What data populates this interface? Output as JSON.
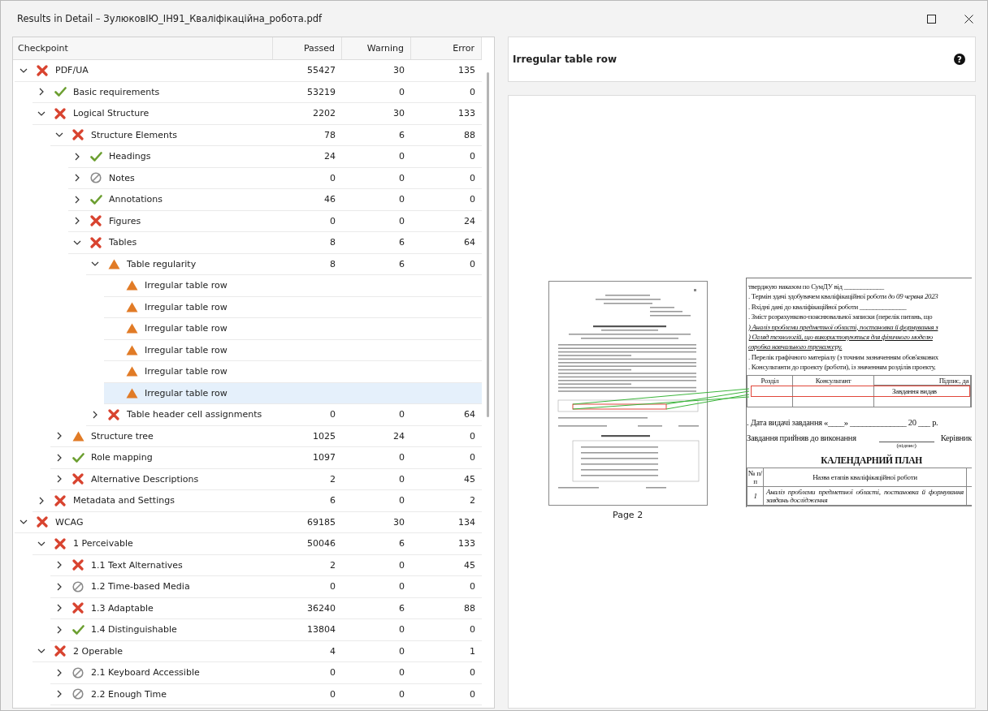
{
  "window": {
    "title": "Results in Detail – ЗулюковІЮ_ІН91_Кваліфікаційна_робота.pdf"
  },
  "table": {
    "columns": [
      "Checkpoint",
      "Passed",
      "Warning",
      "Error"
    ],
    "rows": [
      {
        "label": "PDF/UA",
        "kind": "error",
        "expanded": true,
        "selected": false,
        "passed": "55427",
        "warning": "30",
        "error": "135",
        "children": [
          {
            "label": "Basic requirements",
            "kind": "passed",
            "expanded": false,
            "selected": false,
            "passed": "53219",
            "warning": "0",
            "error": "0"
          },
          {
            "label": "Logical Structure",
            "kind": "error",
            "expanded": true,
            "selected": false,
            "passed": "2202",
            "warning": "30",
            "error": "133",
            "children": [
              {
                "label": "Structure Elements",
                "kind": "error",
                "expanded": true,
                "selected": false,
                "passed": "78",
                "warning": "6",
                "error": "88",
                "children": [
                  {
                    "label": "Headings",
                    "kind": "passed",
                    "expanded": false,
                    "selected": false,
                    "passed": "24",
                    "warning": "0",
                    "error": "0"
                  },
                  {
                    "label": "Notes",
                    "kind": "skipped",
                    "expanded": false,
                    "selected": false,
                    "passed": "0",
                    "warning": "0",
                    "error": "0"
                  },
                  {
                    "label": "Annotations",
                    "kind": "passed",
                    "expanded": false,
                    "selected": false,
                    "passed": "46",
                    "warning": "0",
                    "error": "0"
                  },
                  {
                    "label": "Figures",
                    "kind": "error",
                    "expanded": false,
                    "selected": false,
                    "passed": "0",
                    "warning": "0",
                    "error": "24"
                  },
                  {
                    "label": "Tables",
                    "kind": "error",
                    "expanded": true,
                    "selected": false,
                    "passed": "8",
                    "warning": "6",
                    "error": "64",
                    "children": [
                      {
                        "label": "Table regularity",
                        "kind": "warning",
                        "expanded": true,
                        "selected": false,
                        "passed": "8",
                        "warning": "6",
                        "error": "0",
                        "children": [
                          {
                            "label": "Irregular table row",
                            "kind": "warning",
                            "selected": false
                          },
                          {
                            "label": "Irregular table row",
                            "kind": "warning",
                            "selected": false
                          },
                          {
                            "label": "Irregular table row",
                            "kind": "warning",
                            "selected": false
                          },
                          {
                            "label": "Irregular table row",
                            "kind": "warning",
                            "selected": false
                          },
                          {
                            "label": "Irregular table row",
                            "kind": "warning",
                            "selected": false
                          },
                          {
                            "label": "Irregular table row",
                            "kind": "warning",
                            "selected": true
                          }
                        ]
                      },
                      {
                        "label": "Table header cell assignments",
                        "kind": "error",
                        "expanded": false,
                        "selected": false,
                        "passed": "0",
                        "warning": "0",
                        "error": "64"
                      }
                    ]
                  }
                ]
              },
              {
                "label": "Structure tree",
                "kind": "warning",
                "expanded": false,
                "selected": false,
                "passed": "1025",
                "warning": "24",
                "error": "0"
              },
              {
                "label": "Role mapping",
                "kind": "passed",
                "expanded": false,
                "selected": false,
                "passed": "1097",
                "warning": "0",
                "error": "0"
              },
              {
                "label": "Alternative Descriptions",
                "kind": "error",
                "expanded": false,
                "selected": false,
                "passed": "2",
                "warning": "0",
                "error": "45"
              }
            ]
          },
          {
            "label": "Metadata and Settings",
            "kind": "error",
            "expanded": false,
            "selected": false,
            "passed": "6",
            "warning": "0",
            "error": "2"
          }
        ]
      },
      {
        "label": "WCAG",
        "kind": "error",
        "expanded": true,
        "selected": false,
        "passed": "69185",
        "warning": "30",
        "error": "134",
        "children": [
          {
            "label": "1 Perceivable",
            "kind": "error",
            "expanded": true,
            "selected": false,
            "passed": "50046",
            "warning": "6",
            "error": "133",
            "children": [
              {
                "label": "1.1 Text Alternatives",
                "kind": "error",
                "expanded": false,
                "selected": false,
                "passed": "2",
                "warning": "0",
                "error": "45"
              },
              {
                "label": "1.2 Time-based Media",
                "kind": "skipped",
                "expanded": false,
                "selected": false,
                "passed": "0",
                "warning": "0",
                "error": "0"
              },
              {
                "label": "1.3 Adaptable",
                "kind": "error",
                "expanded": false,
                "selected": false,
                "passed": "36240",
                "warning": "6",
                "error": "88"
              },
              {
                "label": "1.4 Distinguishable",
                "kind": "passed",
                "expanded": false,
                "selected": false,
                "passed": "13804",
                "warning": "0",
                "error": "0"
              }
            ]
          },
          {
            "label": "2 Operable",
            "kind": "error",
            "expanded": true,
            "selected": false,
            "passed": "4",
            "warning": "0",
            "error": "1",
            "children": [
              {
                "label": "2.1 Keyboard Accessible",
                "kind": "skipped",
                "expanded": false,
                "selected": false,
                "passed": "0",
                "warning": "0",
                "error": "0"
              },
              {
                "label": "2.2 Enough Time",
                "kind": "skipped",
                "expanded": false,
                "selected": false,
                "passed": "0",
                "warning": "0",
                "error": "0"
              }
            ]
          }
        ]
      }
    ]
  },
  "detail": {
    "title": "Irregular table row",
    "help_icon": "?"
  },
  "preview": {
    "page_caption": "Page 2",
    "magnified": {
      "lines": [
        {
          "kind": "plain",
          "text": "тверджую наказом по СумДУ від ____________"
        },
        {
          "kind": "plain",
          "text": ". Термін здачі здобувачем кваліфікаційної роботи *до 09 червня 2023*"
        },
        {
          "kind": "plain",
          "text": ". Вхідні дані до кваліфікаційної роботи ______________"
        },
        {
          "kind": "plain",
          "text": ". Зміст розрахунково-пояснювальної записки (перелік питань, що"
        },
        {
          "kind": "emphasis",
          "text": ") Аналіз проблеми предметної області, постановка й формування з"
        },
        {
          "kind": "emphasis",
          "text": ") Огляд технологій, що використовуються для фізичного моделю"
        },
        {
          "kind": "emphasis",
          "text": "озробка навчального тренажеру."
        },
        {
          "kind": "plain",
          "text": ". Перелік графічного матеріалу (з точним зазначенням обов'язкових"
        },
        {
          "kind": "plain",
          "text": ". Консультанти до проекту (роботи), із значенням розділів проекту,"
        }
      ],
      "consultants": {
        "headers": [
          "Розділ",
          "Консультант",
          "Підпис, да"
        ],
        "subheader": "Завдання видав"
      },
      "date_line": ". Дата видачі завдання «____» ______________ 20 ___ р.",
      "accept_line": "Завдання прийняв до виконання",
      "signature_hint": "(підпис)",
      "supervisor": "Керівник",
      "plan": {
        "title": "КАЛЕНДАРНИЙ ПЛАН",
        "headers": [
          "№ п/п",
          "Назва етапів кваліфікаційної роботи"
        ],
        "rows": [
          {
            "number": "1",
            "stage": "Аналіз проблеми предметної області, постановка й формування завдань дослідження"
          }
        ]
      }
    }
  }
}
